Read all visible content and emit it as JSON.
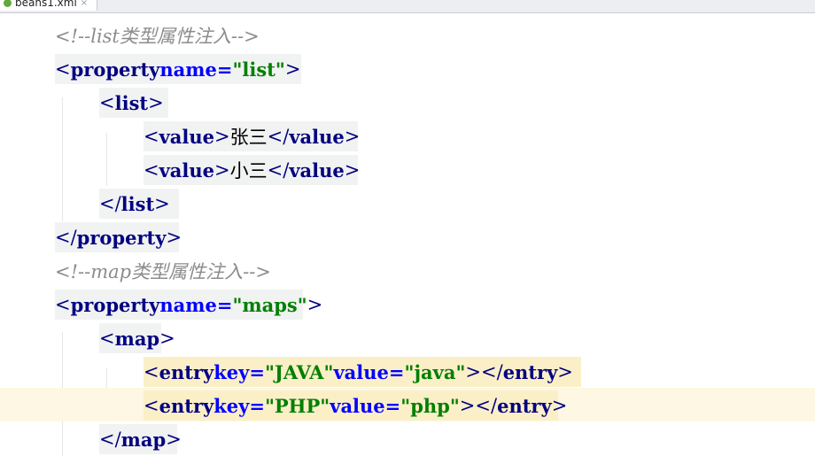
{
  "tab": {
    "file_name": "beans1.xml",
    "close_glyph": "×"
  },
  "code": {
    "comment_list": "<!--list类型属性注入-->",
    "property_list_name": "\"list\"",
    "value_1": "张三",
    "value_2": "小三",
    "comment_map": "<!--map类型属性注入-->",
    "property_map_name": "\"maps\"",
    "entry_1_key": "\"JAVA\"",
    "entry_1_value": "\"java\"",
    "entry_2_key": "\"PHP\"",
    "entry_2_value_before_caret": "\"php",
    "entry_2_value_after_caret": "\""
  },
  "syntax": {
    "tag": "property",
    "list_tag": "list",
    "value_tag": "value",
    "map_tag": "map",
    "entry_tag": "entry",
    "name_attr": "name=",
    "key_attr": "key=",
    "value_attr": "value=",
    "lt": "<",
    "gt": ">",
    "close_lt": "</"
  },
  "colors": {
    "tag": "#000080",
    "attribute": "#0000ff",
    "string": "#008000",
    "comment": "#8c8c8c",
    "current_line": "#fdf7e3",
    "tag_highlight": "#fbefc8"
  }
}
